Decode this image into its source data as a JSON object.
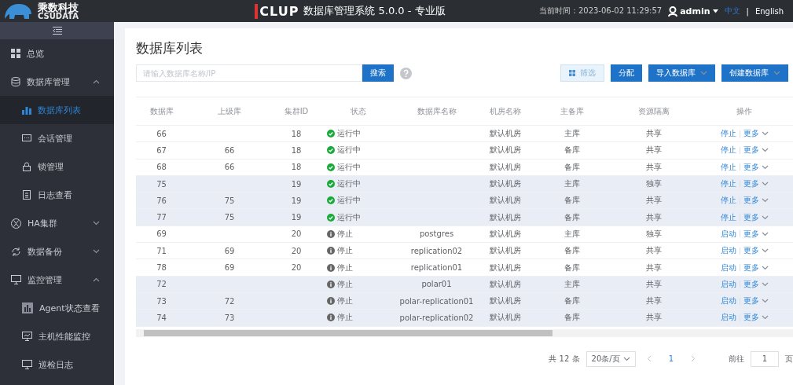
{
  "header": {
    "company": "乘数科技",
    "company_sub": "CSUDATA",
    "product": "CLUP",
    "title": "数据库管理系统 5.0.0 - 专业版",
    "clock": "当前时间：2023-06-02 11:29:57",
    "user": "admin",
    "languages": [
      {
        "label": "中文",
        "selected": true
      },
      {
        "label": "English",
        "selected": false
      }
    ],
    "separator": "|"
  },
  "sidebar": {
    "items": [
      {
        "label": "总览",
        "selected": false
      },
      {
        "label": "数据库管理",
        "expanded": true,
        "children": [
          {
            "label": "数据库列表",
            "selected": true
          },
          {
            "label": "会话管理",
            "selected": false
          },
          {
            "label": "锁管理",
            "selected": false
          },
          {
            "label": "日志查看",
            "selected": false
          }
        ]
      },
      {
        "label": "HA集群",
        "expanded": false
      },
      {
        "label": "数据备份",
        "expanded": false
      },
      {
        "label": "监控管理",
        "expanded": true,
        "children": [
          {
            "label": "Agent状态查看",
            "selected": false
          },
          {
            "label": "主机性能监控",
            "selected": false
          },
          {
            "label": "巡检日志",
            "selected": false
          }
        ]
      }
    ]
  },
  "page": {
    "title": "数据库列表",
    "search": {
      "placeholder": "请输入数据库名称/IP",
      "button": "搜索"
    },
    "toolbar": [
      {
        "label": "筛选",
        "kind": "filter"
      },
      {
        "label": "分配",
        "kind": "plain"
      },
      {
        "label": "导入数据库",
        "kind": "menu"
      },
      {
        "label": "创建数据库",
        "kind": "menu"
      }
    ]
  },
  "table": {
    "columns": [
      "数据库",
      "上级库",
      "集群ID",
      "状态",
      "数据库名称",
      "机房名称",
      "主备库",
      "资源隔离",
      "操作"
    ],
    "rows": [
      {
        "db": "66",
        "parent": "",
        "cluster": "18",
        "status": {
          "kind": "running",
          "label": "运行中"
        },
        "name": "",
        "room": "默认机房",
        "role": "主库",
        "isolation": "共享",
        "action": "停止",
        "more": "更多",
        "highlighted": false
      },
      {
        "db": "67",
        "parent": "66",
        "cluster": "18",
        "status": {
          "kind": "running",
          "label": "运行中"
        },
        "name": "",
        "room": "默认机房",
        "role": "备库",
        "isolation": "共享",
        "action": "停止",
        "more": "更多",
        "highlighted": false
      },
      {
        "db": "68",
        "parent": "66",
        "cluster": "18",
        "status": {
          "kind": "running",
          "label": "运行中"
        },
        "name": "",
        "room": "默认机房",
        "role": "备库",
        "isolation": "共享",
        "action": "停止",
        "more": "更多",
        "highlighted": false
      },
      {
        "db": "75",
        "parent": "",
        "cluster": "19",
        "status": {
          "kind": "running",
          "label": "运行中"
        },
        "name": "",
        "room": "默认机房",
        "role": "主库",
        "isolation": "独享",
        "action": "停止",
        "more": "更多",
        "highlighted": true
      },
      {
        "db": "76",
        "parent": "75",
        "cluster": "19",
        "status": {
          "kind": "running",
          "label": "运行中"
        },
        "name": "",
        "room": "默认机房",
        "role": "备库",
        "isolation": "共享",
        "action": "停止",
        "more": "更多",
        "highlighted": true
      },
      {
        "db": "77",
        "parent": "75",
        "cluster": "19",
        "status": {
          "kind": "running",
          "label": "运行中"
        },
        "name": "",
        "room": "默认机房",
        "role": "备库",
        "isolation": "共享",
        "action": "停止",
        "more": "更多",
        "highlighted": true
      },
      {
        "db": "69",
        "parent": "",
        "cluster": "20",
        "status": {
          "kind": "stopped",
          "label": "停止"
        },
        "name": "postgres",
        "room": "默认机房",
        "role": "主库",
        "isolation": "独享",
        "action": "启动",
        "more": "更多",
        "highlighted": false
      },
      {
        "db": "71",
        "parent": "69",
        "cluster": "20",
        "status": {
          "kind": "stopped",
          "label": "停止"
        },
        "name": "replication02",
        "room": "默认机房",
        "role": "备库",
        "isolation": "共享",
        "action": "启动",
        "more": "更多",
        "highlighted": false
      },
      {
        "db": "78",
        "parent": "69",
        "cluster": "20",
        "status": {
          "kind": "stopped",
          "label": "停止"
        },
        "name": "replication01",
        "room": "默认机房",
        "role": "备库",
        "isolation": "共享",
        "action": "启动",
        "more": "更多",
        "highlighted": false
      },
      {
        "db": "72",
        "parent": "",
        "cluster": "",
        "status": {
          "kind": "stopped",
          "label": "停止"
        },
        "name": "polar01",
        "room": "默认机房",
        "role": "主库",
        "isolation": "共享",
        "action": "启动",
        "more": "更多",
        "highlighted": true
      },
      {
        "db": "73",
        "parent": "72",
        "cluster": "",
        "status": {
          "kind": "stopped",
          "label": "停止"
        },
        "name": "polar-replication01",
        "room": "默认机房",
        "role": "备库",
        "isolation": "共享",
        "action": "启动",
        "more": "更多",
        "highlighted": true
      },
      {
        "db": "74",
        "parent": "73",
        "cluster": "",
        "status": {
          "kind": "stopped",
          "label": "停止"
        },
        "name": "polar-replication02",
        "room": "默认机房",
        "role": "备库",
        "isolation": "共享",
        "action": "启动",
        "more": "更多",
        "highlighted": true
      }
    ]
  },
  "pagination": {
    "total": "共 12 条",
    "page_size": "20条/页",
    "pages": [
      {
        "label": "1",
        "selected": true
      }
    ],
    "goto_label": "前往",
    "goto_value": "1",
    "goto_unit": "页"
  }
}
